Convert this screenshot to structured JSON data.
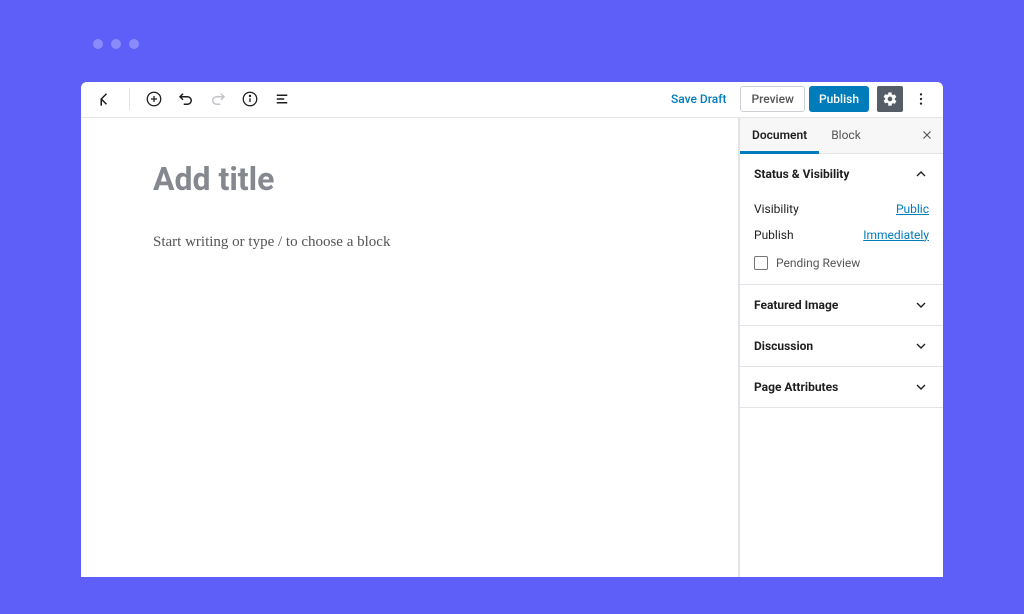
{
  "topbar": {
    "save_draft": "Save Draft",
    "preview": "Preview",
    "publish": "Publish"
  },
  "editor": {
    "title_placeholder": "Add title",
    "body_placeholder": "Start writing or type / to choose a block"
  },
  "sidebar": {
    "tabs": {
      "document": "Document",
      "block": "Block"
    },
    "panels": {
      "status": {
        "title": "Status & Visibility",
        "visibility_label": "Visibility",
        "visibility_value": "Public",
        "publish_label": "Publish",
        "publish_value": "Immediately",
        "pending_label": "Pending Review"
      },
      "featured_image": "Featured Image",
      "discussion": "Discussion",
      "page_attributes": "Page Attributes"
    }
  }
}
